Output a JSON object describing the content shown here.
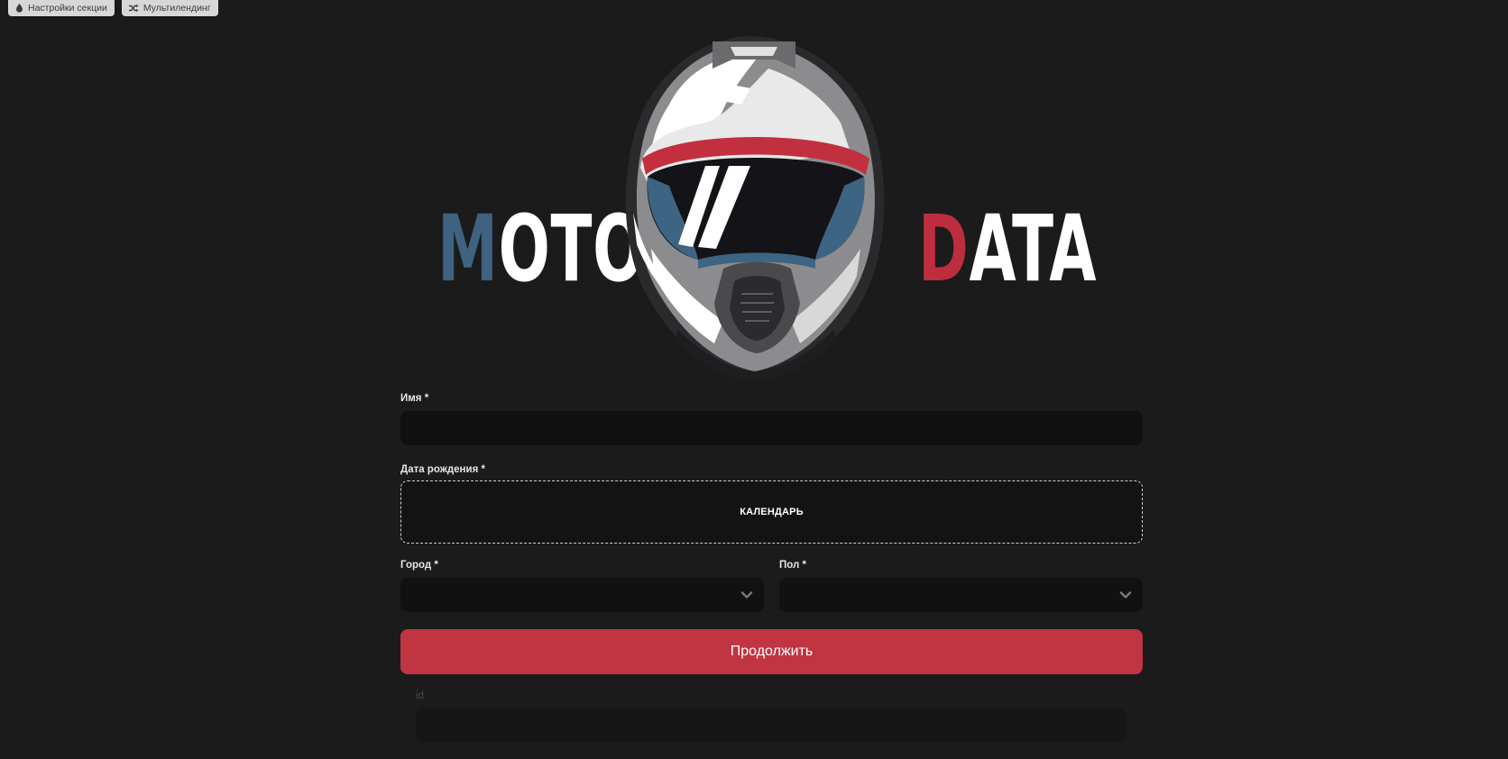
{
  "editor_toolbar": {
    "section_settings": "Настройки секции",
    "multilanding": "Мультилендинг"
  },
  "logo": {
    "left_first": "M",
    "left_rest": "OTO",
    "right_first": "D",
    "right_rest": "ATA",
    "colors": {
      "blue": "#3e6280",
      "red": "#bd2d3e",
      "white": "#ffffff"
    }
  },
  "form": {
    "name": {
      "label": "Имя",
      "required_mark": "*",
      "value": ""
    },
    "birthdate": {
      "label": "Дата рождения",
      "required_mark": "*",
      "button_label": "КАЛЕНДАРЬ"
    },
    "city": {
      "label": "Город",
      "required_mark": "*",
      "selected": ""
    },
    "gender": {
      "label": "Пол",
      "required_mark": "*",
      "selected": ""
    },
    "submit_label": "Продолжить",
    "id_field": {
      "label": "id",
      "value": ""
    }
  },
  "colors": {
    "background": "#1b1b1c",
    "input_bg": "#111111",
    "accent": "#c13442"
  }
}
